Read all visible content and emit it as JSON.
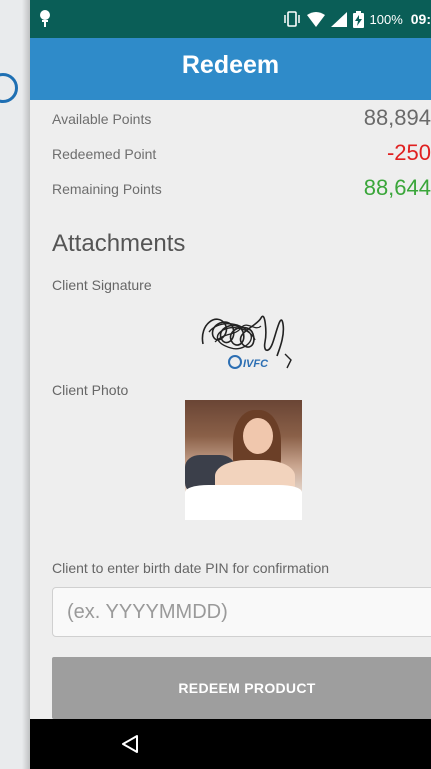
{
  "status_bar": {
    "battery_text": "100%",
    "clock_text": "09:",
    "bar_color": "#0a5e57"
  },
  "app_bar": {
    "title": "Redeem",
    "color": "#2f8bc9"
  },
  "points": {
    "available_label": "Available Points",
    "available_value": "88,894",
    "redeemed_label": "Redeemed Point",
    "redeemed_value": "-250",
    "remaining_label": "Remaining Points",
    "remaining_value": "88,644",
    "negative_color": "#e02020",
    "positive_color": "#3aa63a"
  },
  "attachments": {
    "section_title": "Attachments",
    "signature_label": "Client Signature",
    "signature_watermark": "IVFC",
    "photo_label": "Client Photo"
  },
  "confirmation": {
    "pin_label": "Client to enter birth date PIN for confirmation",
    "pin_placeholder": "(ex. YYYYMMDD)",
    "pin_value": ""
  },
  "actions": {
    "redeem_button_label": "REDEEM PRODUCT",
    "redeem_button_color": "#9e9e9e"
  },
  "nav_bar": {
    "back_icon": "back-triangle-icon"
  }
}
